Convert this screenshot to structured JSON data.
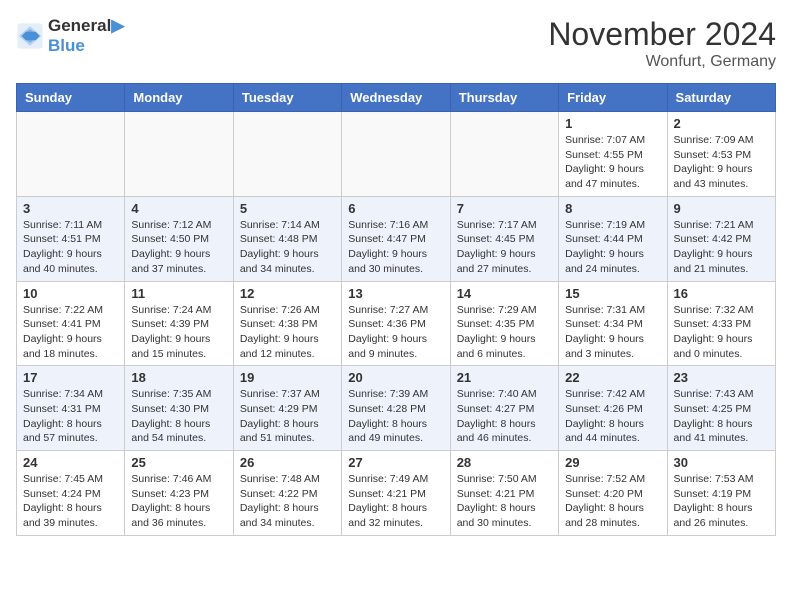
{
  "header": {
    "logo_line1": "General",
    "logo_line2": "Blue",
    "month": "November 2024",
    "location": "Wonfurt, Germany"
  },
  "days_of_week": [
    "Sunday",
    "Monday",
    "Tuesday",
    "Wednesday",
    "Thursday",
    "Friday",
    "Saturday"
  ],
  "weeks": [
    [
      {
        "day": "",
        "info": ""
      },
      {
        "day": "",
        "info": ""
      },
      {
        "day": "",
        "info": ""
      },
      {
        "day": "",
        "info": ""
      },
      {
        "day": "",
        "info": ""
      },
      {
        "day": "1",
        "info": "Sunrise: 7:07 AM\nSunset: 4:55 PM\nDaylight: 9 hours and 47 minutes."
      },
      {
        "day": "2",
        "info": "Sunrise: 7:09 AM\nSunset: 4:53 PM\nDaylight: 9 hours and 43 minutes."
      }
    ],
    [
      {
        "day": "3",
        "info": "Sunrise: 7:11 AM\nSunset: 4:51 PM\nDaylight: 9 hours and 40 minutes."
      },
      {
        "day": "4",
        "info": "Sunrise: 7:12 AM\nSunset: 4:50 PM\nDaylight: 9 hours and 37 minutes."
      },
      {
        "day": "5",
        "info": "Sunrise: 7:14 AM\nSunset: 4:48 PM\nDaylight: 9 hours and 34 minutes."
      },
      {
        "day": "6",
        "info": "Sunrise: 7:16 AM\nSunset: 4:47 PM\nDaylight: 9 hours and 30 minutes."
      },
      {
        "day": "7",
        "info": "Sunrise: 7:17 AM\nSunset: 4:45 PM\nDaylight: 9 hours and 27 minutes."
      },
      {
        "day": "8",
        "info": "Sunrise: 7:19 AM\nSunset: 4:44 PM\nDaylight: 9 hours and 24 minutes."
      },
      {
        "day": "9",
        "info": "Sunrise: 7:21 AM\nSunset: 4:42 PM\nDaylight: 9 hours and 21 minutes."
      }
    ],
    [
      {
        "day": "10",
        "info": "Sunrise: 7:22 AM\nSunset: 4:41 PM\nDaylight: 9 hours and 18 minutes."
      },
      {
        "day": "11",
        "info": "Sunrise: 7:24 AM\nSunset: 4:39 PM\nDaylight: 9 hours and 15 minutes."
      },
      {
        "day": "12",
        "info": "Sunrise: 7:26 AM\nSunset: 4:38 PM\nDaylight: 9 hours and 12 minutes."
      },
      {
        "day": "13",
        "info": "Sunrise: 7:27 AM\nSunset: 4:36 PM\nDaylight: 9 hours and 9 minutes."
      },
      {
        "day": "14",
        "info": "Sunrise: 7:29 AM\nSunset: 4:35 PM\nDaylight: 9 hours and 6 minutes."
      },
      {
        "day": "15",
        "info": "Sunrise: 7:31 AM\nSunset: 4:34 PM\nDaylight: 9 hours and 3 minutes."
      },
      {
        "day": "16",
        "info": "Sunrise: 7:32 AM\nSunset: 4:33 PM\nDaylight: 9 hours and 0 minutes."
      }
    ],
    [
      {
        "day": "17",
        "info": "Sunrise: 7:34 AM\nSunset: 4:31 PM\nDaylight: 8 hours and 57 minutes."
      },
      {
        "day": "18",
        "info": "Sunrise: 7:35 AM\nSunset: 4:30 PM\nDaylight: 8 hours and 54 minutes."
      },
      {
        "day": "19",
        "info": "Sunrise: 7:37 AM\nSunset: 4:29 PM\nDaylight: 8 hours and 51 minutes."
      },
      {
        "day": "20",
        "info": "Sunrise: 7:39 AM\nSunset: 4:28 PM\nDaylight: 8 hours and 49 minutes."
      },
      {
        "day": "21",
        "info": "Sunrise: 7:40 AM\nSunset: 4:27 PM\nDaylight: 8 hours and 46 minutes."
      },
      {
        "day": "22",
        "info": "Sunrise: 7:42 AM\nSunset: 4:26 PM\nDaylight: 8 hours and 44 minutes."
      },
      {
        "day": "23",
        "info": "Sunrise: 7:43 AM\nSunset: 4:25 PM\nDaylight: 8 hours and 41 minutes."
      }
    ],
    [
      {
        "day": "24",
        "info": "Sunrise: 7:45 AM\nSunset: 4:24 PM\nDaylight: 8 hours and 39 minutes."
      },
      {
        "day": "25",
        "info": "Sunrise: 7:46 AM\nSunset: 4:23 PM\nDaylight: 8 hours and 36 minutes."
      },
      {
        "day": "26",
        "info": "Sunrise: 7:48 AM\nSunset: 4:22 PM\nDaylight: 8 hours and 34 minutes."
      },
      {
        "day": "27",
        "info": "Sunrise: 7:49 AM\nSunset: 4:21 PM\nDaylight: 8 hours and 32 minutes."
      },
      {
        "day": "28",
        "info": "Sunrise: 7:50 AM\nSunset: 4:21 PM\nDaylight: 8 hours and 30 minutes."
      },
      {
        "day": "29",
        "info": "Sunrise: 7:52 AM\nSunset: 4:20 PM\nDaylight: 8 hours and 28 minutes."
      },
      {
        "day": "30",
        "info": "Sunrise: 7:53 AM\nSunset: 4:19 PM\nDaylight: 8 hours and 26 minutes."
      }
    ]
  ]
}
